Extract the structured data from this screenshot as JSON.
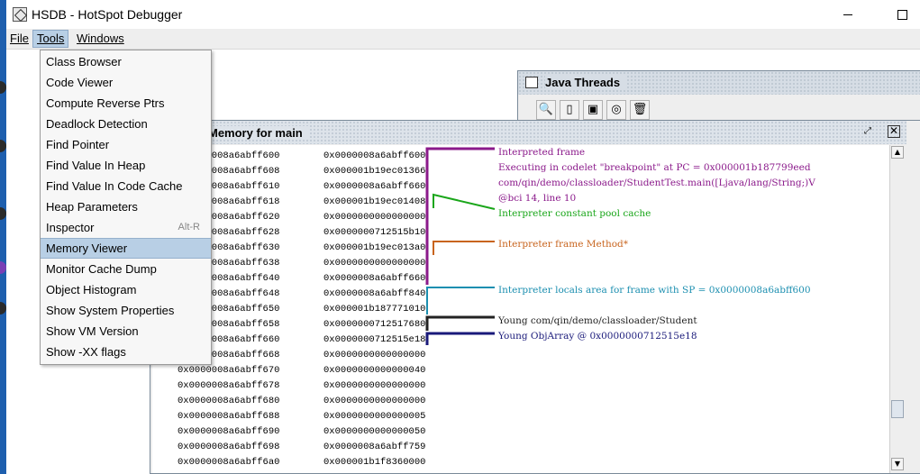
{
  "window": {
    "title": "HSDB - HotSpot Debugger"
  },
  "menubar": [
    "File",
    "Tools",
    "Windows"
  ],
  "tools_menu": [
    {
      "label": "Class Browser"
    },
    {
      "label": "Code Viewer"
    },
    {
      "label": "Compute Reverse Ptrs"
    },
    {
      "label": "Deadlock Detection"
    },
    {
      "label": "Find Pointer"
    },
    {
      "label": "Find Value In Heap"
    },
    {
      "label": "Find Value In Code Cache"
    },
    {
      "label": "Heap Parameters"
    },
    {
      "label": "Inspector",
      "accelerator": "Alt-R"
    },
    {
      "label": "Memory Viewer",
      "selected": true
    },
    {
      "label": "Monitor Cache Dump"
    },
    {
      "label": "Object Histogram"
    },
    {
      "label": "Show System Properties"
    },
    {
      "label": "Show VM Version"
    },
    {
      "label": "Show -XX flags"
    }
  ],
  "java_threads": {
    "title": "Java Threads",
    "toolbar_icons": [
      "inspect-thread-icon",
      "stack-memory-icon",
      "thread-info-icon",
      "find-crash-icon",
      "delete-icon"
    ]
  },
  "memory_viewer": {
    "title": "Memory for main",
    "rows": [
      {
        "addr": "0x0000008a6abff600",
        "value": "0x0000008a6abff600"
      },
      {
        "addr": "0x0000008a6abff608",
        "value": "0x000001b19ec01366"
      },
      {
        "addr": "0x0000008a6abff610",
        "value": "0x0000008a6abff660"
      },
      {
        "addr": "0x0000008a6abff618",
        "value": "0x000001b19ec01408"
      },
      {
        "addr": "0x0000008a6abff620",
        "value": "0x0000000000000000"
      },
      {
        "addr": "0x0000008a6abff628",
        "value": "0x0000000712515b10"
      },
      {
        "addr": "0x0000008a6abff630",
        "value": "0x000001b19ec013a0"
      },
      {
        "addr": "0x0000008a6abff638",
        "value": "0x0000000000000000"
      },
      {
        "addr": "0x0000008a6abff640",
        "value": "0x0000008a6abff660"
      },
      {
        "addr": "0x0000008a6abff648",
        "value": "0x0000008a6abff840"
      },
      {
        "addr": "0x0000008a6abff650",
        "value": "0x000001b187771010"
      },
      {
        "addr": "0x0000008a6abff658",
        "value": "0x0000000712517680"
      },
      {
        "addr": "0x0000008a6abff660",
        "value": "0x0000000712515e18"
      },
      {
        "addr": "0x0000008a6abff668",
        "value": "0x0000000000000000"
      },
      {
        "addr": "0x0000008a6abff670",
        "value": "0x0000000000000040"
      },
      {
        "addr": "0x0000008a6abff678",
        "value": "0x0000000000000000"
      },
      {
        "addr": "0x0000008a6abff680",
        "value": "0x0000000000000000"
      },
      {
        "addr": "0x0000008a6abff688",
        "value": "0x0000000000000005"
      },
      {
        "addr": "0x0000008a6abff690",
        "value": "0x0000000000000050"
      },
      {
        "addr": "0x0000008a6abff698",
        "value": "0x0000008a6abff759"
      },
      {
        "addr": "0x0000008a6abff6a0",
        "value": "0x000001b1f8360000"
      }
    ],
    "annotations": [
      {
        "text": "Interpreted frame",
        "color": "#8b1a8b"
      },
      {
        "text": "Executing in codelet \"breakpoint\" at PC = 0x000001b187799eed",
        "color": "#8b1a8b"
      },
      {
        "text": "com/qin/demo/classloader/StudentTest.main([Ljava/lang/String;)V",
        "color": "#8b1a8b"
      },
      {
        "text": "@bci 14, line 10",
        "color": "#8b1a8b"
      },
      {
        "text": "Interpreter constant pool cache",
        "color": "#1aa61a"
      },
      {
        "text": "Interpreter frame Method*",
        "color": "#c8641e"
      },
      {
        "text": "Interpreter locals area for frame with SP = 0x0000008a6abff600",
        "color": "#1c8fb0"
      },
      {
        "text": "Young com/qin/demo/classloader/Student",
        "color": "#222222"
      },
      {
        "text": "Young ObjArray @ 0x0000000712515e18",
        "color": "#1a1a7a"
      }
    ]
  }
}
